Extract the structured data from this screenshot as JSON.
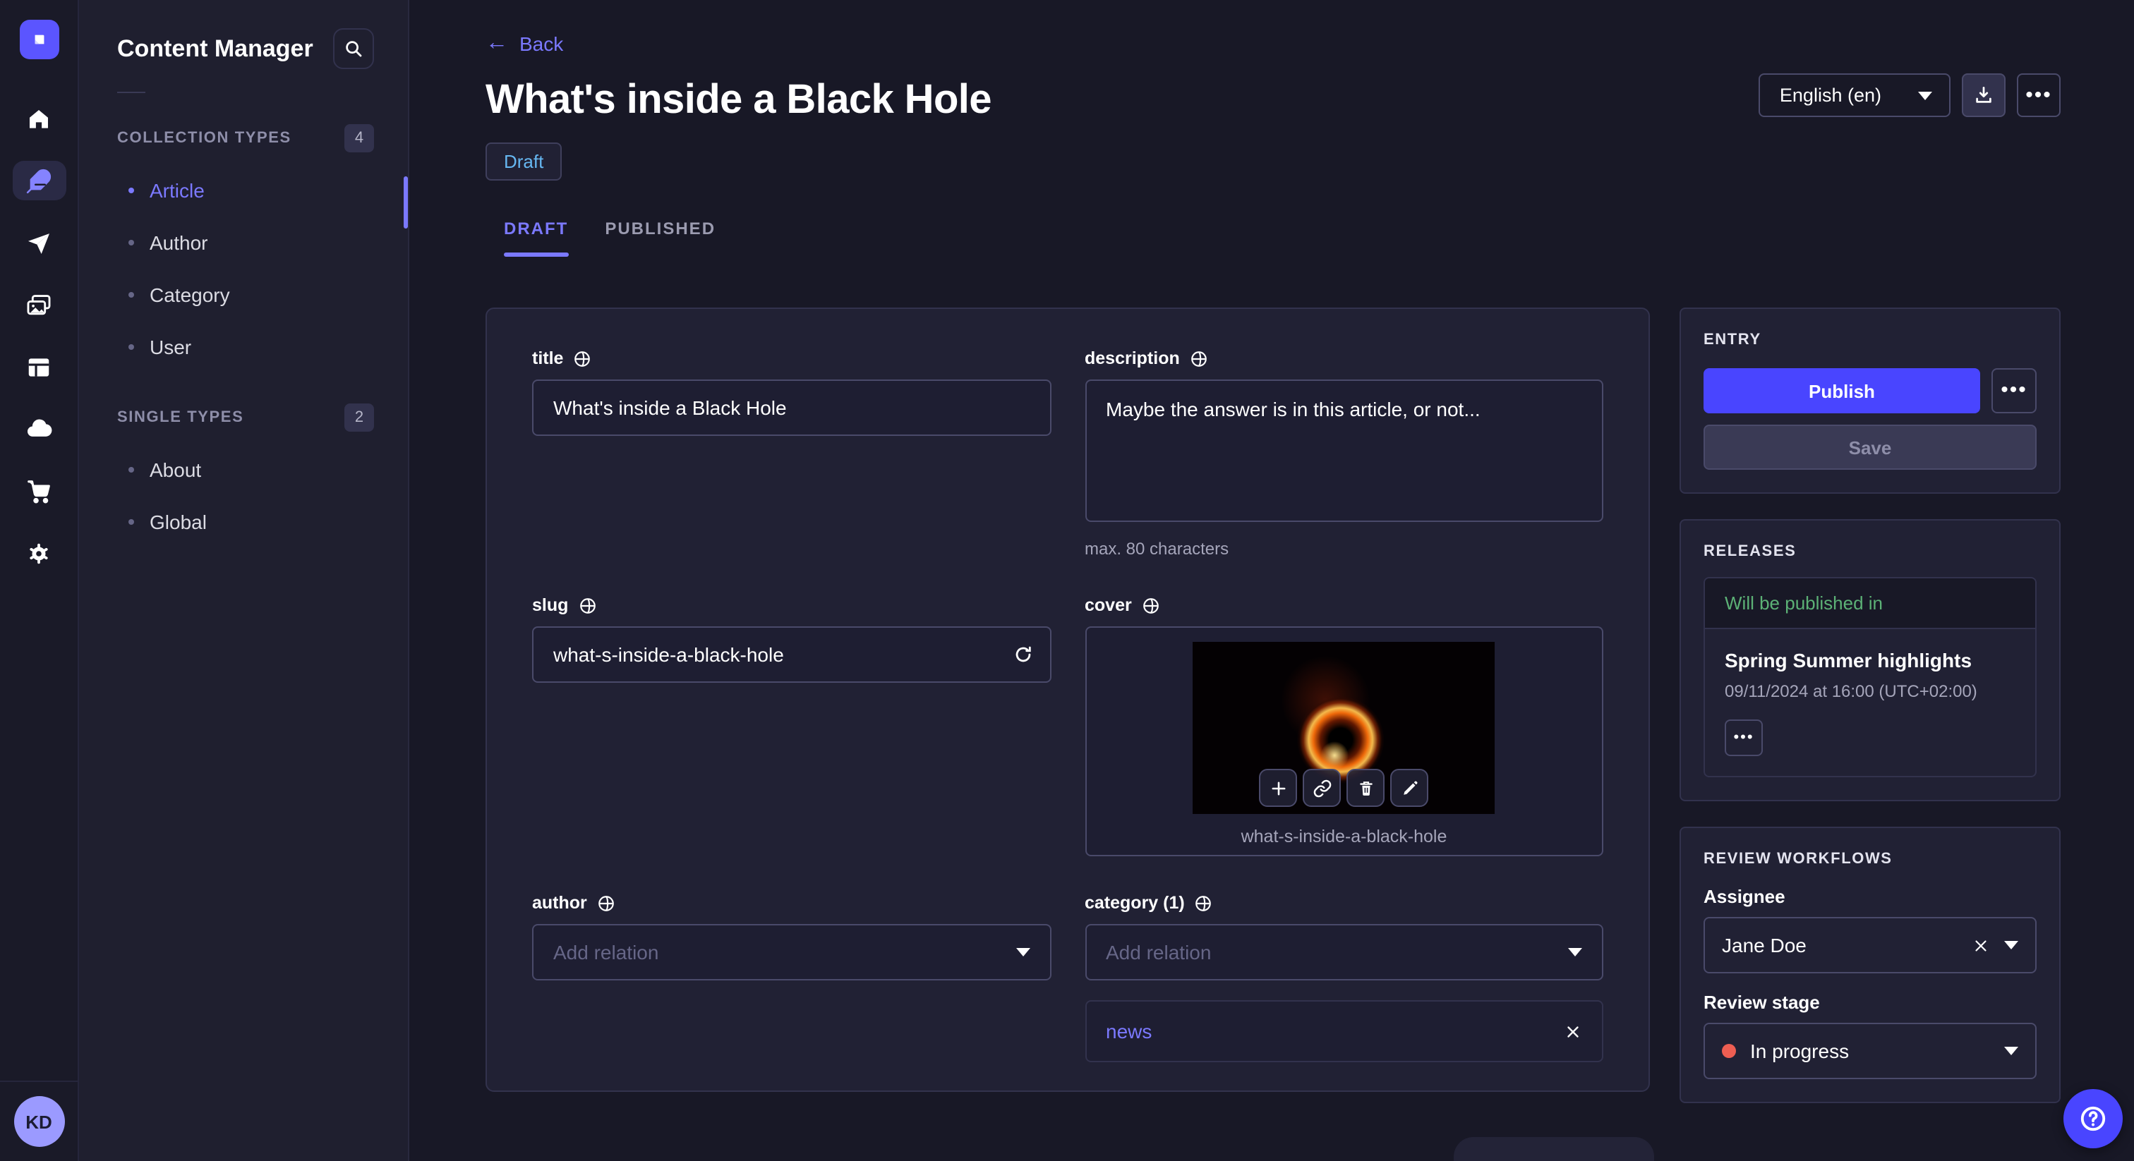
{
  "colors": {
    "accent": "#4945ff",
    "accent_text": "#7b79ff",
    "draft_text": "#66b7f1",
    "success_text": "#5cb176",
    "danger_dot": "#ee5e52",
    "card_bg": "#212134",
    "app_bg": "#181826",
    "avatar_bg": "#9b9aff"
  },
  "rail": {
    "icons": [
      "strapi-logo",
      "home",
      "feather",
      "paper-plane",
      "media-library",
      "layout",
      "cloud",
      "shopping-cart",
      "settings-gear"
    ],
    "active_icon": "feather",
    "avatar": "KD"
  },
  "subnav": {
    "title": "Content Manager",
    "search_icon": "search",
    "sections": [
      {
        "label": "COLLECTION TYPES",
        "count": "4",
        "items": [
          {
            "label": "Article"
          },
          {
            "label": "Author"
          },
          {
            "label": "Category"
          },
          {
            "label": "User"
          }
        ]
      },
      {
        "label": "SINGLE TYPES",
        "count": "2",
        "items": [
          {
            "label": "About"
          },
          {
            "label": "Global"
          }
        ]
      }
    ]
  },
  "header": {
    "back": "Back",
    "back_arrow": "←",
    "title": "What's inside a Black Hole",
    "status": "Draft",
    "locale": "English (en)",
    "tabs": [
      {
        "label": "DRAFT"
      },
      {
        "label": "PUBLISHED"
      }
    ]
  },
  "form": {
    "title": {
      "label": "title",
      "value": "What's inside a Black Hole"
    },
    "description": {
      "label": "description",
      "value": "Maybe the answer is in this article, or not...",
      "hint": "max. 80 characters"
    },
    "slug": {
      "label": "slug",
      "value": "what-s-inside-a-black-hole"
    },
    "cover": {
      "label": "cover",
      "filename": "what-s-inside-a-black-hole"
    },
    "author": {
      "label": "author",
      "placeholder": "Add relation"
    },
    "category": {
      "label": "category (1)",
      "placeholder": "Add relation",
      "relations": [
        {
          "label": "news"
        }
      ]
    }
  },
  "entry": {
    "label": "ENTRY",
    "publish": "Publish",
    "save": "Save"
  },
  "releases": {
    "label": "RELEASES",
    "status": "Will be published in",
    "name": "Spring Summer highlights",
    "date": "09/11/2024 at 16:00 (UTC+02:00)"
  },
  "review": {
    "label": "REVIEW WORKFLOWS",
    "assignee_label": "Assignee",
    "assignee": "Jane Doe",
    "stage_label": "Review stage",
    "stage": "In progress"
  }
}
